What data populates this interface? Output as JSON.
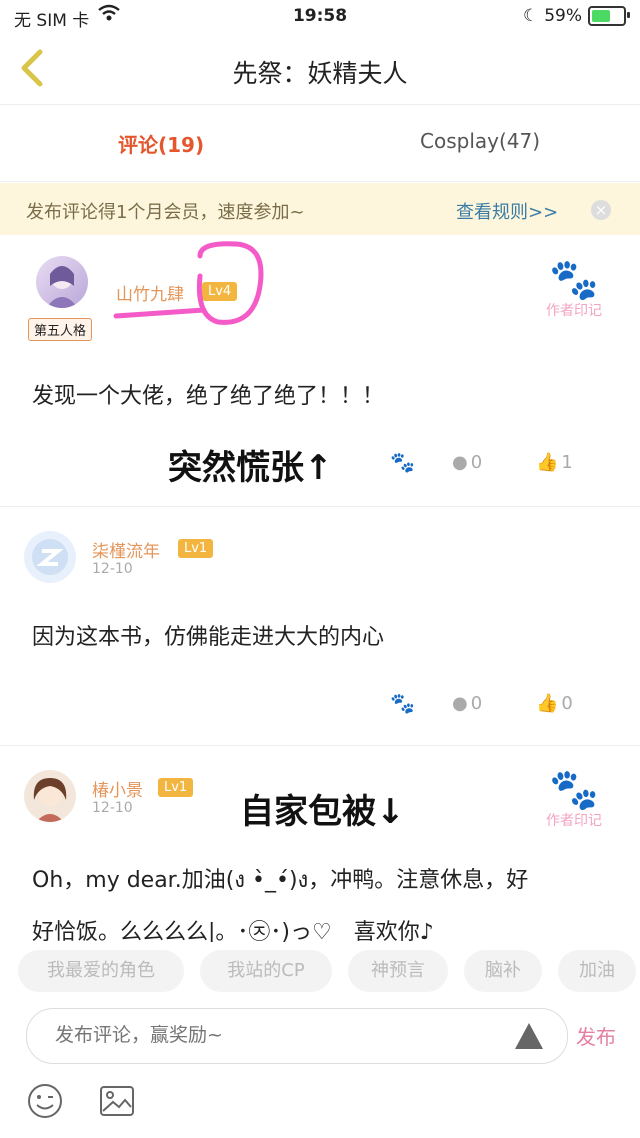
{
  "status": {
    "carrier": "无 SIM 卡",
    "time": "19:58",
    "battery": "59%",
    "battery_level": 0.59
  },
  "nav": {
    "title": "先祭：妖精夫人"
  },
  "tabs": [
    {
      "label": "评论(19)",
      "active": true
    },
    {
      "label": "Cosplay(47)",
      "active": false
    }
  ],
  "banner": {
    "text": "发布评论得1个月会员，速度参加~",
    "link": "查看规则>>"
  },
  "comments": [
    {
      "user": "山竹九肆",
      "level": "Lv4",
      "badge": "第五人格",
      "text": "发现一个大佬，绝了绝了绝了！！！",
      "author_mark": "作者印记",
      "comments_count": "0",
      "likes": "1",
      "annotation": "突然慌张↑"
    },
    {
      "user": "柒槿流年",
      "level": "Lv1",
      "date": "12-10",
      "text": "因为这本书，仿佛能走进大大的内心",
      "comments_count": "0",
      "likes": "0"
    },
    {
      "user": "椿小景",
      "level": "Lv1",
      "date": "12-10",
      "text_line1": "Oh，my dear.加油(ง •̀_•́)ง，冲鸭。注意休息，好",
      "text_line2": "好恰饭。么么么么|。･㉨･)っ♡　喜欢你♪",
      "author_mark": "作者印记",
      "annotation": "自家包被↓"
    }
  ],
  "chips": [
    "我最爱的角色",
    "我站的CP",
    "神预言",
    "脑补",
    "加油"
  ],
  "input": {
    "placeholder": "发布评论，赢奖励~",
    "publish": "发布"
  },
  "colors": {
    "accent": "#e4572e",
    "level_badge": "#f2b640",
    "pink": "#e57fa3"
  }
}
